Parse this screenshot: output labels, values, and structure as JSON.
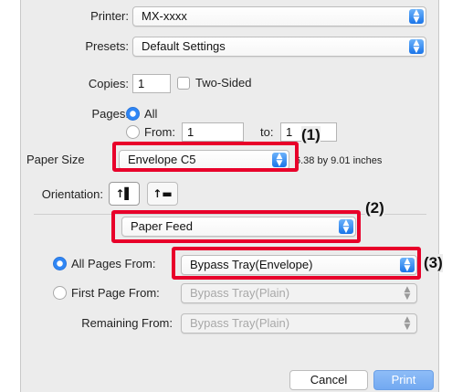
{
  "printer": {
    "label": "Printer:",
    "value": "MX-xxxx"
  },
  "presets": {
    "label": "Presets:",
    "value": "Default Settings"
  },
  "copies": {
    "label": "Copies:",
    "value": "1",
    "two_sided_label": "Two-Sided"
  },
  "pages": {
    "label": "Pages:",
    "all_label": "All",
    "from_label": "From:",
    "from_value": "1",
    "to_label": "to:",
    "to_value": "1"
  },
  "paper_size": {
    "label": "Paper Size",
    "value": "Envelope C5",
    "dimensions": "6.38 by 9.01 inches"
  },
  "orientation": {
    "label": "Orientation:",
    "portrait_glyph": "↑▌",
    "landscape_glyph": "↑▬"
  },
  "section_popup": {
    "value": "Paper Feed"
  },
  "feed": {
    "all_pages_label": "All Pages From:",
    "all_pages_value": "Bypass Tray(Envelope)",
    "first_page_label": "First Page From:",
    "first_page_value": "Bypass Tray(Plain)",
    "remaining_label": "Remaining From:",
    "remaining_value": "Bypass Tray(Plain)"
  },
  "buttons": {
    "cancel": "Cancel",
    "print": "Print"
  },
  "callouts": {
    "c1": "(1)",
    "c2": "(2)",
    "c3": "(3)"
  },
  "colors": {
    "accent": "#2f86f5",
    "callout": "#e8002a"
  }
}
